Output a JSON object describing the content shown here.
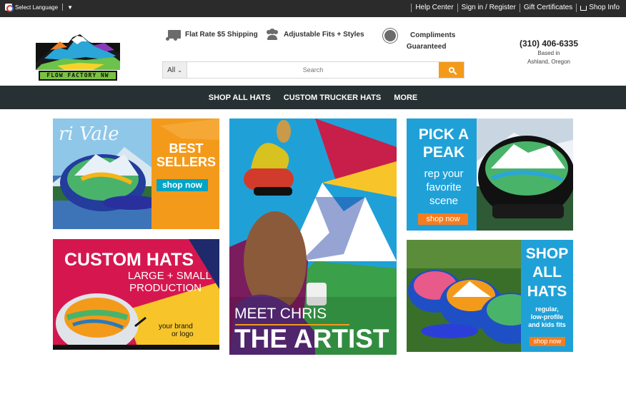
{
  "topbar": {
    "language_label": "Select Language",
    "links": [
      "Help Center",
      "Sign in / Register",
      "Gift Certificates",
      "Shop Info"
    ]
  },
  "header": {
    "logo_text": "FLOW FACTORY NW",
    "features": {
      "shipping": "Flat Rate $5 Shipping",
      "fits": "Adjustable Fits + Styles",
      "compliments_line1": "Compliments",
      "compliments_line2": "Guaranteed"
    },
    "search": {
      "category": "All",
      "placeholder": "Search"
    },
    "phone": "(310) 406-6335",
    "location_line1": "Based in",
    "location_line2": "Ashland, Oregon"
  },
  "nav": {
    "items": [
      "SHOP ALL HATS",
      "CUSTOM TRUCKER HATS",
      "MORE"
    ]
  },
  "tiles": {
    "best_sellers": {
      "line1": "BEST",
      "line2": "SELLERS",
      "button": "shop now"
    },
    "meet_chris": {
      "line1": "MEET CHRIS",
      "line2": "THE ARTIST"
    },
    "pick_a_peak": {
      "line1": "PICK A",
      "line2": "PEAK",
      "sub1": "rep your",
      "sub2": "favorite",
      "sub3": "scene",
      "button": "shop now"
    },
    "custom_hats": {
      "title": "CUSTOM HATS",
      "sub1": "LARGE + SMALL",
      "sub2": "PRODUCTION",
      "note1": "your brand",
      "note2": "or logo"
    },
    "shop_all": {
      "line1": "SHOP",
      "line2": "ALL",
      "line3": "HATS",
      "sub1": "regular,",
      "sub2": "low-profile",
      "sub3": "and kids fits",
      "button": "shop now"
    }
  },
  "colors": {
    "accent": "#f39a1b",
    "nav_bg": "#273033",
    "topbar_bg": "#2b2b2b",
    "teal": "#00a4c4"
  }
}
